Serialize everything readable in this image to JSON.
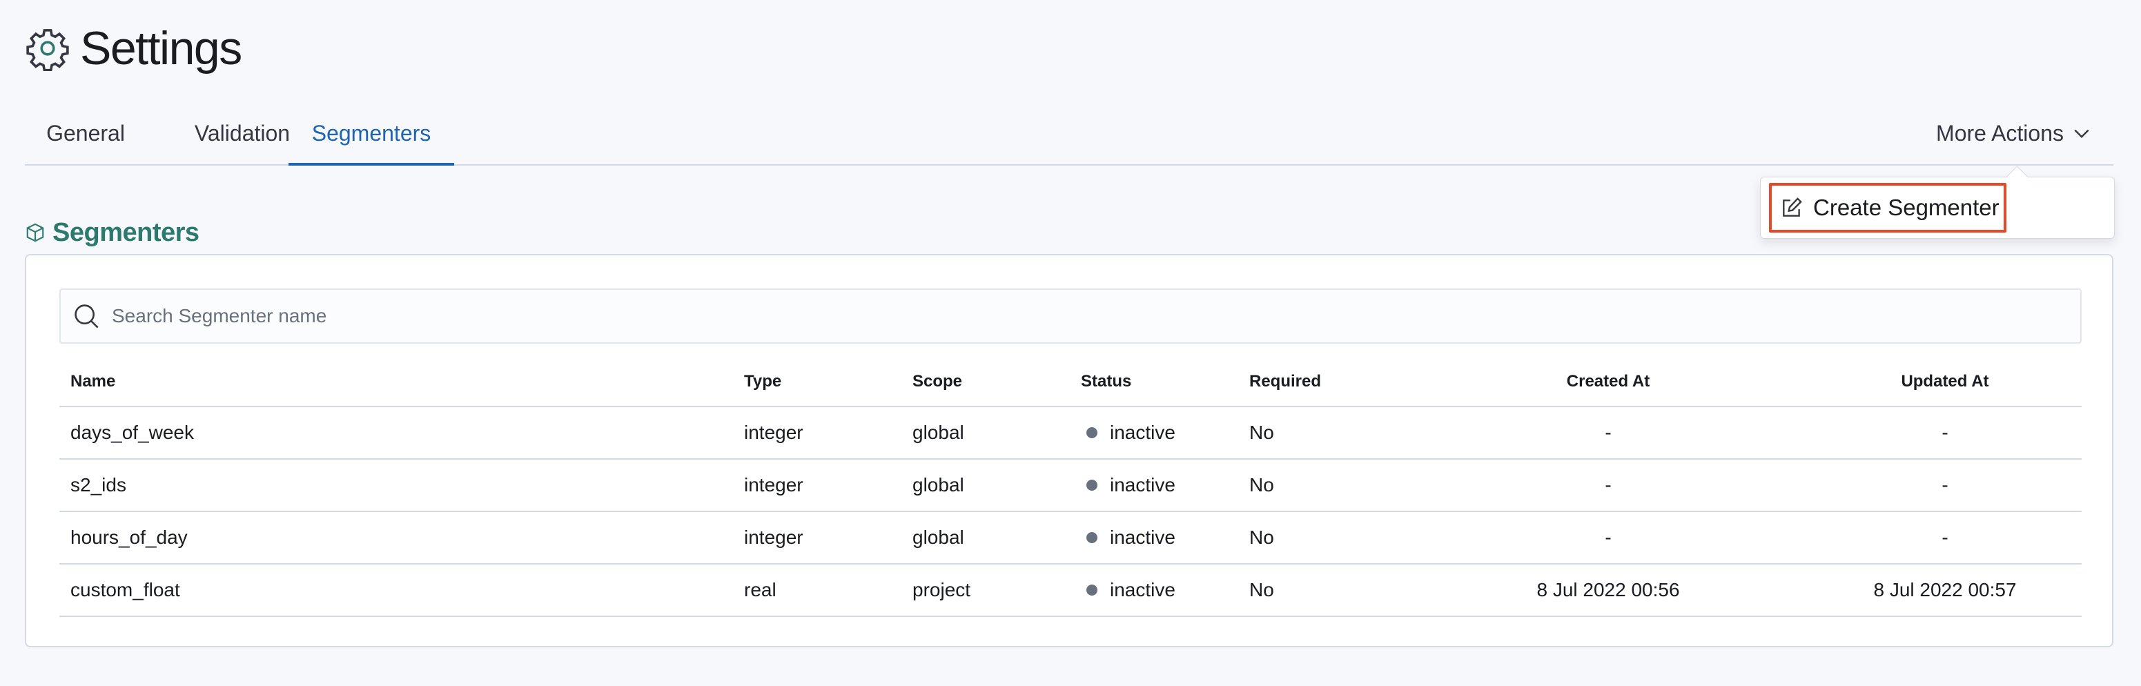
{
  "header": {
    "title": "Settings",
    "icon": "gear-icon"
  },
  "tabs": [
    {
      "label": "General",
      "active": false
    },
    {
      "label": "Validation",
      "active": false
    },
    {
      "label": "Segmenters",
      "active": true
    }
  ],
  "more_actions": {
    "label": "More Actions",
    "menu": [
      {
        "label": "Create Segmenter",
        "icon": "edit-icon"
      }
    ]
  },
  "section": {
    "title": "Segmenters",
    "icon": "cube-icon"
  },
  "search": {
    "placeholder": "Search Segmenter name",
    "value": ""
  },
  "table": {
    "columns": [
      "Name",
      "Type",
      "Scope",
      "Status",
      "Required",
      "Created At",
      "Updated At"
    ],
    "rows": [
      {
        "name": "days_of_week",
        "type": "integer",
        "scope": "global",
        "status": "inactive",
        "required": "No",
        "created_at": "-",
        "updated_at": "-"
      },
      {
        "name": "s2_ids",
        "type": "integer",
        "scope": "global",
        "status": "inactive",
        "required": "No",
        "created_at": "-",
        "updated_at": "-"
      },
      {
        "name": "hours_of_day",
        "type": "integer",
        "scope": "global",
        "status": "inactive",
        "required": "No",
        "created_at": "-",
        "updated_at": "-"
      },
      {
        "name": "custom_float",
        "type": "real",
        "scope": "project",
        "status": "inactive",
        "required": "No",
        "created_at": "8 Jul 2022 00:56",
        "updated_at": "8 Jul 2022 00:57"
      }
    ]
  },
  "colors": {
    "accent": "#1f64b0",
    "section_title": "#2c7a6e",
    "highlight_border": "#e34a2a",
    "status_inactive": "#69707d",
    "page_bg": "#f7f8fc"
  }
}
